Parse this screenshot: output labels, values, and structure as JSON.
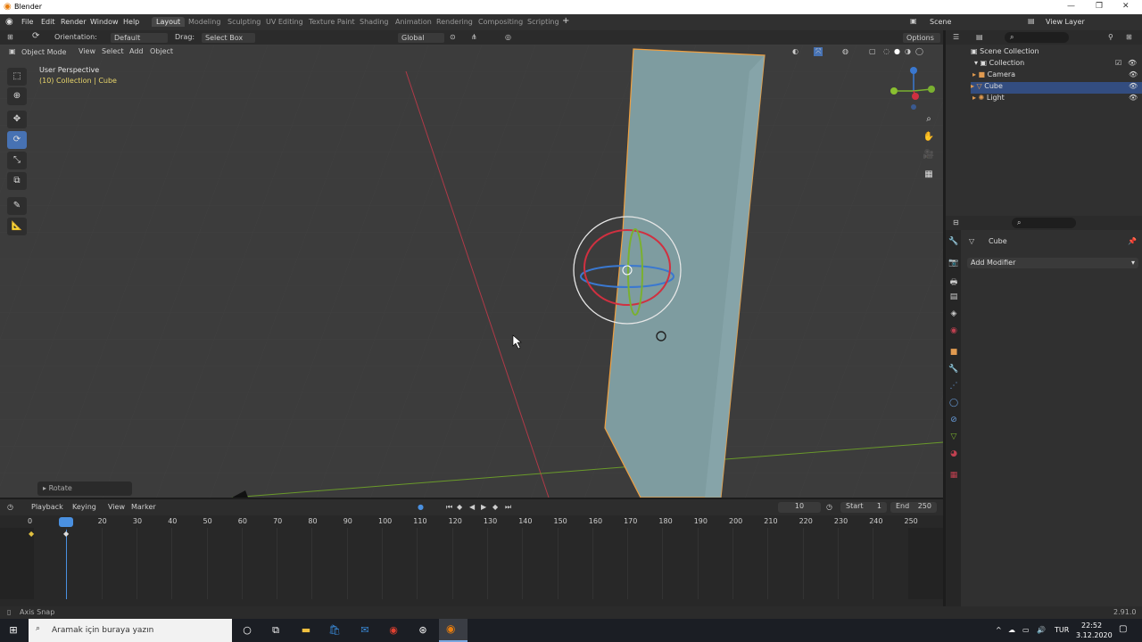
{
  "titlebar": {
    "title": "Blender"
  },
  "menubar": {
    "menus": [
      "File",
      "Edit",
      "Render",
      "Window",
      "Help"
    ],
    "workspaces": [
      "Layout",
      "Modeling",
      "Sculpting",
      "UV Editing",
      "Texture Paint",
      "Shading",
      "Animation",
      "Rendering",
      "Compositing",
      "Scripting"
    ],
    "active_workspace": "Layout",
    "scene_label": "Scene",
    "view_layer_label": "View Layer"
  },
  "tool_header": {
    "orientation_label": "Orientation:",
    "orientation_value": "Default",
    "drag_label": "Drag:",
    "drag_value": "Select Box",
    "transform_orientation": "Global",
    "options_label": "Options"
  },
  "viewport_header": {
    "mode": "Object Mode",
    "menus": [
      "View",
      "Select",
      "Add",
      "Object"
    ]
  },
  "viewport": {
    "perspective_text": "User Perspective",
    "collection_text": "(10) Collection | Cube",
    "operator_panel_label": "Rotate"
  },
  "outliner": {
    "search_placeholder": "",
    "items": [
      {
        "label": "Scene Collection",
        "level": 0
      },
      {
        "label": "Collection",
        "level": 1
      },
      {
        "label": "Camera",
        "level": 2
      },
      {
        "label": "Cube",
        "level": 2,
        "selected": true
      },
      {
        "label": "Light",
        "level": 2
      }
    ]
  },
  "properties": {
    "object_name": "Cube",
    "add_modifier_label": "Add Modifier"
  },
  "timeline": {
    "menus": [
      "Playback",
      "Keying",
      "View",
      "Marker"
    ],
    "current_frame": "10",
    "start_label": "Start",
    "start_value": "1",
    "end_label": "End",
    "end_value": "250",
    "frame_ticks": [
      "0",
      "10",
      "20",
      "30",
      "40",
      "50",
      "60",
      "70",
      "80",
      "90",
      "100",
      "110",
      "120",
      "130",
      "140",
      "150",
      "160",
      "170",
      "180",
      "190",
      "200",
      "210",
      "220",
      "230",
      "240",
      "250"
    ]
  },
  "statusbar": {
    "left": "Axis Snap",
    "version": "2.91.0"
  },
  "taskbar": {
    "search_placeholder": "Aramak için buraya yazın",
    "lang": "TUR",
    "time": "22:52",
    "date": "3.12.2020"
  },
  "icons": [
    "blender-icon",
    "search-icon",
    "eye-icon",
    "camera-icon",
    "light-icon",
    "mesh-icon",
    "wrench-icon",
    "zoom-icon",
    "hand-icon"
  ]
}
